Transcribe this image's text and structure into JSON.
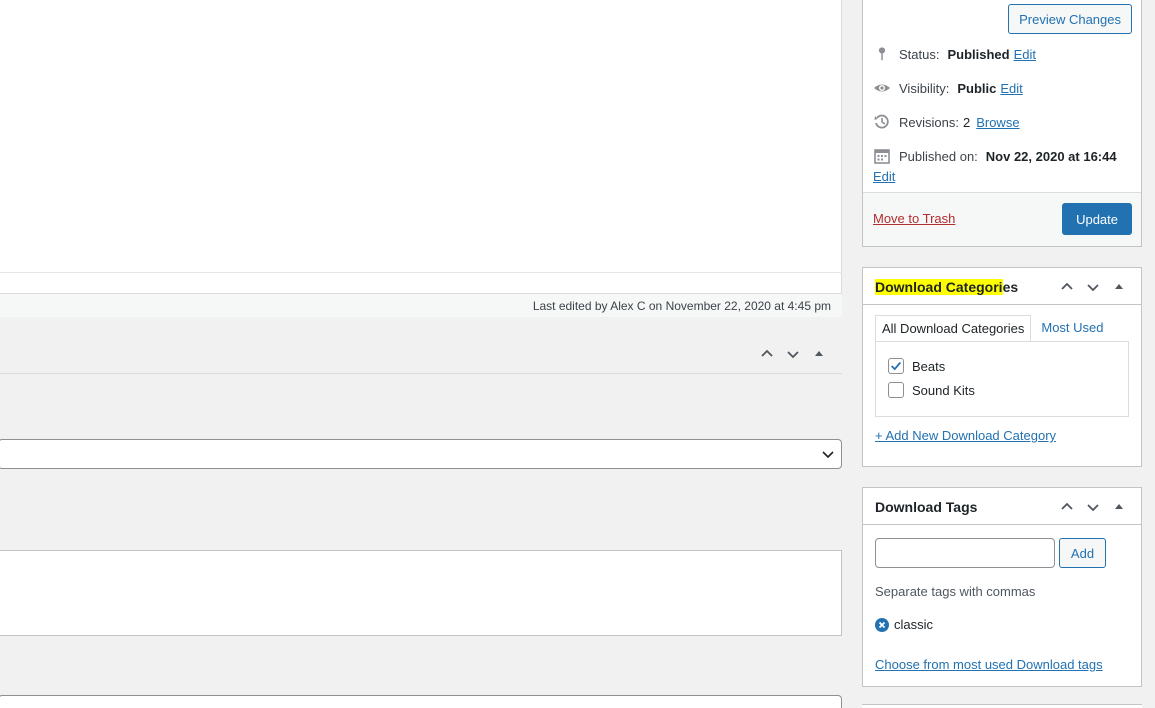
{
  "editor": {
    "last_edited": "Last edited by Alex C on November 22, 2020 at 4:45 pm"
  },
  "publish": {
    "preview_label": "Preview Changes",
    "status_label": "Status:",
    "status_value": "Published",
    "status_edit": "Edit",
    "visibility_label": "Visibility:",
    "visibility_value": "Public",
    "visibility_edit": "Edit",
    "revisions_label": "Revisions:",
    "revisions_value": "2",
    "revisions_browse": "Browse",
    "published_label": "Published on:",
    "published_value": "Nov 22, 2020 at 16:44",
    "published_edit": "Edit",
    "trash_label": "Move to Trash",
    "update_label": "Update"
  },
  "categories": {
    "title_highlighted": "Download Categori",
    "title_rest": "es",
    "tab_all": "All Download Categories",
    "tab_most_used": "Most Used",
    "items": [
      {
        "label": "Beats",
        "checked": true
      },
      {
        "label": "Sound Kits",
        "checked": false
      }
    ],
    "add_new": "+ Add New Download Category"
  },
  "tags": {
    "title": "Download Tags",
    "input_value": "",
    "add_label": "Add",
    "hint": "Separate tags with commas",
    "tag_items": [
      "classic"
    ],
    "choose_link": "Choose from most used Download tags"
  },
  "colors": {
    "accent": "#2271b1",
    "danger": "#b32d2e",
    "highlight": "#ffff00"
  }
}
